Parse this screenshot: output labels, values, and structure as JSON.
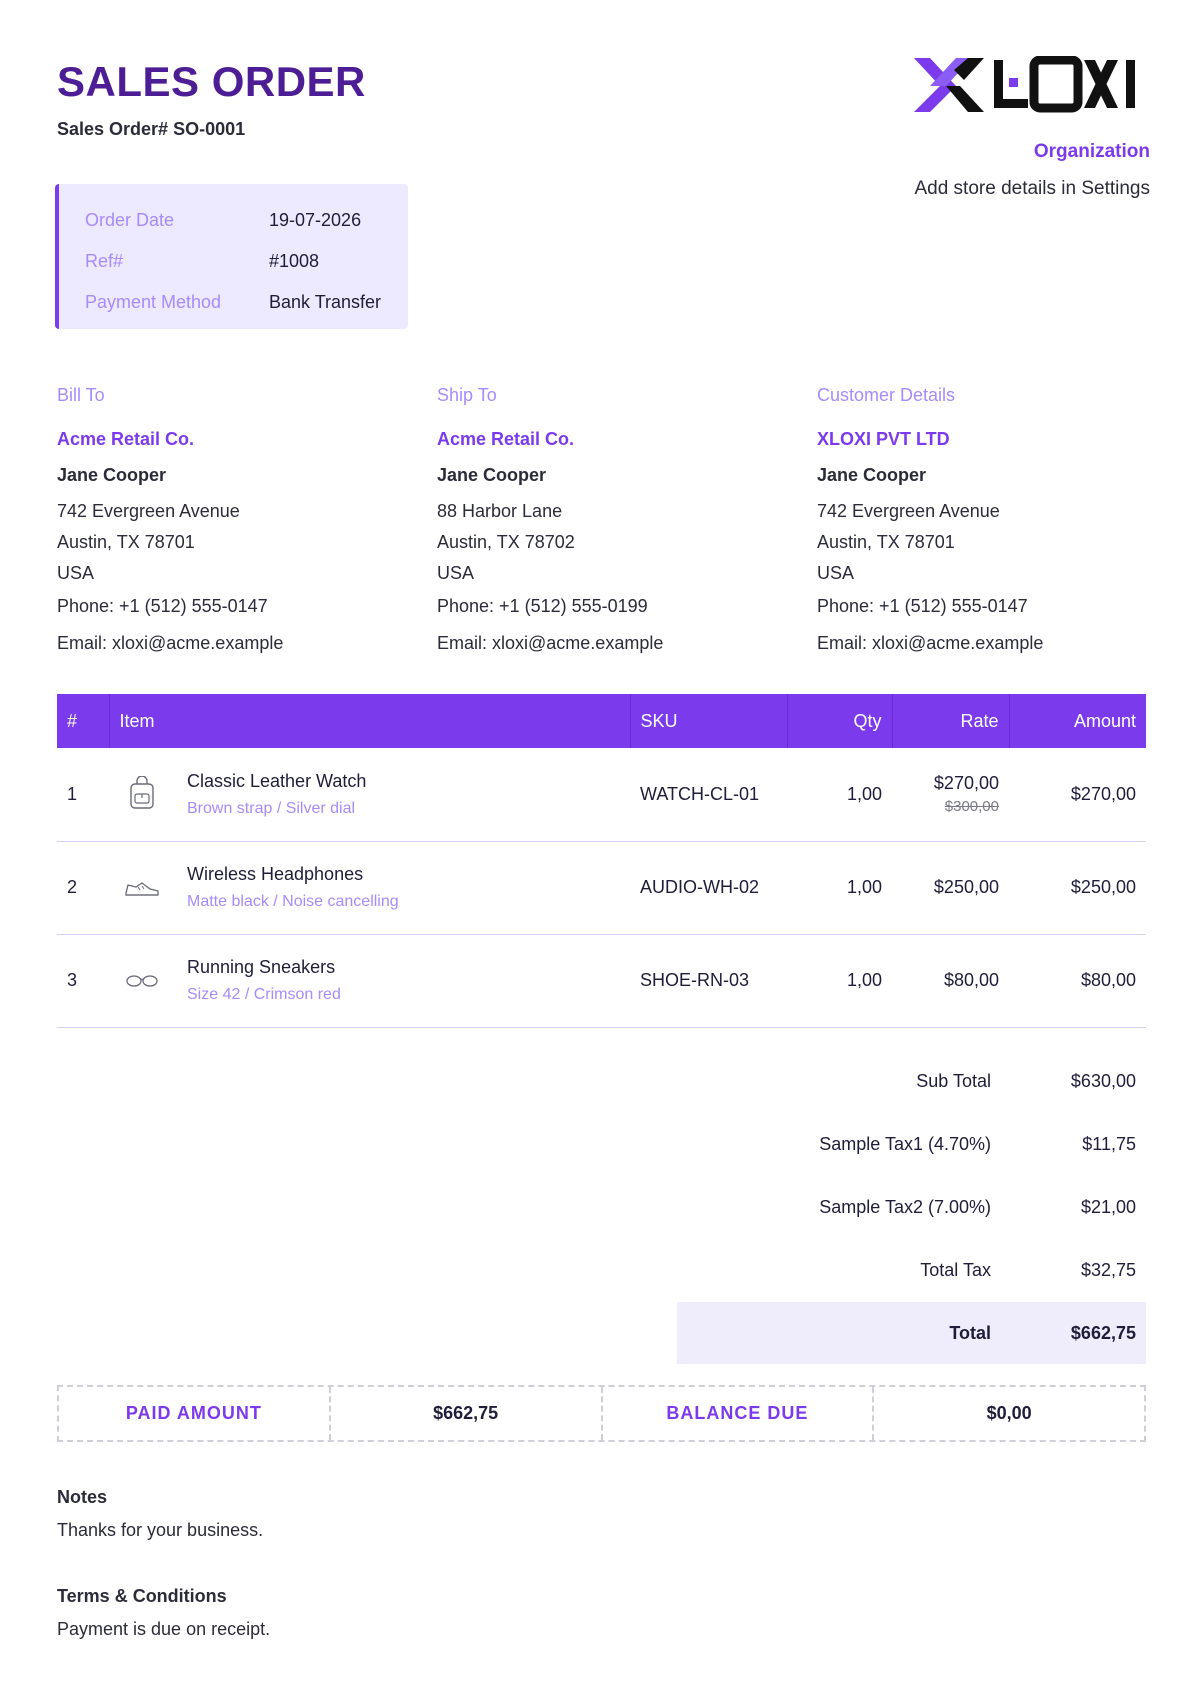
{
  "document": {
    "title": "SALES ORDER",
    "number": "Sales Order# SO-0001"
  },
  "organization": {
    "logo_text": "XLOXI",
    "name": "Organization",
    "hint": "Add store details in Settings",
    "brand_color": "#7c3aed"
  },
  "meta": [
    {
      "label": "Order Date",
      "value": "19-07-2026"
    },
    {
      "label": "Ref#",
      "value": "#1008"
    },
    {
      "label": "Payment Method",
      "value": "Bank Transfer"
    }
  ],
  "bill_to": {
    "heading": "Bill To",
    "company": "Acme Retail Co.",
    "name": "Jane Cooper",
    "street": "742 Evergreen Avenue",
    "city": "Austin, TX 78701",
    "country": "USA",
    "phone": "Phone: +1 (512) 555-0147",
    "email": "Email: xloxi@acme.example"
  },
  "ship_to": {
    "heading": "Ship To",
    "company": "Acme Retail Co.",
    "name": "Jane Cooper",
    "street": "88 Harbor Lane",
    "city": "Austin, TX 78702",
    "country": "USA",
    "phone": "Phone: +1 (512) 555-0199",
    "email": "Email: xloxi@acme.example"
  },
  "customer": {
    "heading": "Customer Details",
    "company": "XLOXI PVT LTD",
    "name": "Jane Cooper",
    "street": "742 Evergreen Avenue",
    "city": "Austin, TX 78701",
    "country": "USA",
    "phone": "Phone: +1 (512) 555-0147",
    "email": "Email: xloxi@acme.example"
  },
  "table": {
    "headers": {
      "num": "#",
      "item": "Item",
      "sku": "SKU",
      "qty": "Qty",
      "rate": "Rate",
      "amount": "Amount"
    },
    "rows": [
      {
        "num": "1",
        "icon": "backpack-icon",
        "name": "Classic Leather Watch",
        "variant": "Brown strap / Silver dial",
        "sku": "WATCH-CL-01",
        "qty": "1,00",
        "rate": "$270,00",
        "rate_old": "$300,00",
        "amount": "$270,00"
      },
      {
        "num": "2",
        "icon": "sneaker-icon",
        "name": "Wireless Headphones",
        "variant": "Matte black / Noise cancelling",
        "sku": "AUDIO-WH-02",
        "qty": "1,00",
        "rate": "$250,00",
        "amount": "$250,00"
      },
      {
        "num": "3",
        "icon": "glasses-icon",
        "name": "Running Sneakers",
        "variant": "Size 42 / Crimson red",
        "sku": "SHOE-RN-03",
        "qty": "1,00",
        "rate": "$80,00",
        "amount": "$80,00"
      }
    ]
  },
  "totals": {
    "subtotal_label": "Sub Total",
    "subtotal": "$630,00",
    "tax1_label": "Sample Tax1 (4.70%)",
    "tax1": "$11,75",
    "tax2_label": "Sample Tax2 (7.00%)",
    "tax2": "$21,00",
    "total_tax_label": "Total Tax",
    "total_tax": "$32,75",
    "total_label": "Total",
    "total": "$662,75"
  },
  "payment": {
    "paid_label": "PAID AMOUNT",
    "paid": "$662,75",
    "balance_label": "BALANCE DUE",
    "balance": "$0,00"
  },
  "notes": {
    "title": "Notes",
    "body": "Thanks for your business."
  },
  "terms": {
    "title": "Terms & Conditions",
    "body": "Payment is due on receipt."
  }
}
